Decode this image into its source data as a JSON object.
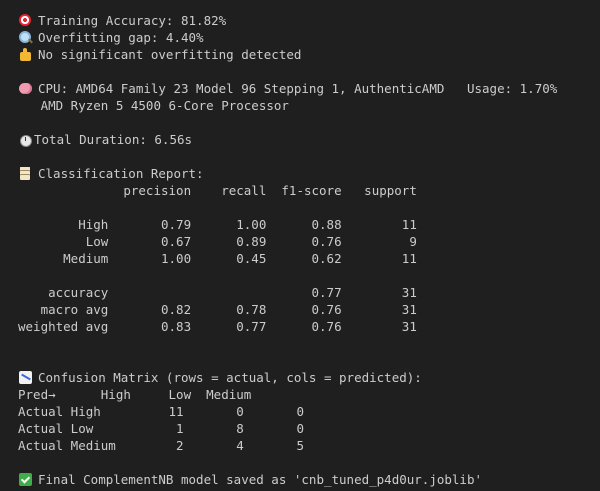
{
  "summary": {
    "training_accuracy": "Training Accuracy: 81.82%",
    "overfitting_gap": "Overfitting gap: 4.40%",
    "overfitting_status": "No significant overfitting detected"
  },
  "system": {
    "cpu_line": "CPU: AMD64 Family 23 Model 96 Stepping 1, AuthenticAMD   Usage: 1.70%",
    "cpu_name": "   AMD Ryzen 5 4500 6-Core Processor",
    "duration": "Total Duration: 6.56s"
  },
  "classification_report": {
    "heading": "Classification Report:",
    "header_line": "              precision    recall  f1-score   support",
    "rows": [
      "        High       0.79      1.00      0.88        11",
      "         Low       0.67      0.89      0.76         9",
      "      Medium       1.00      0.45      0.62        11",
      "",
      "    accuracy                           0.77        31",
      "   macro avg       0.82      0.78      0.76        31",
      "weighted avg       0.83      0.77      0.76        31"
    ]
  },
  "confusion_matrix": {
    "heading": "Confusion Matrix (rows = actual, cols = predicted):",
    "header_line": "Pred→      High     Low  Medium",
    "rows": [
      "Actual High         11       0       0",
      "Actual Low           1       8       0",
      "Actual Medium        2       4       5"
    ]
  },
  "final": {
    "saved_message": "Final ComplementNB model saved as 'cnb_tuned_p4d0ur.joblib'"
  },
  "icons": {
    "accuracy": "target-icon",
    "gap": "magnifier-icon",
    "status": "thumbs-up-icon",
    "cpu": "brain-icon",
    "duration": "stopwatch-icon",
    "report": "memo-icon",
    "matrix": "chart-icon",
    "final": "check-mark-icon"
  },
  "colors": {
    "background": "#1f1f1f",
    "text": "#cccccc"
  }
}
